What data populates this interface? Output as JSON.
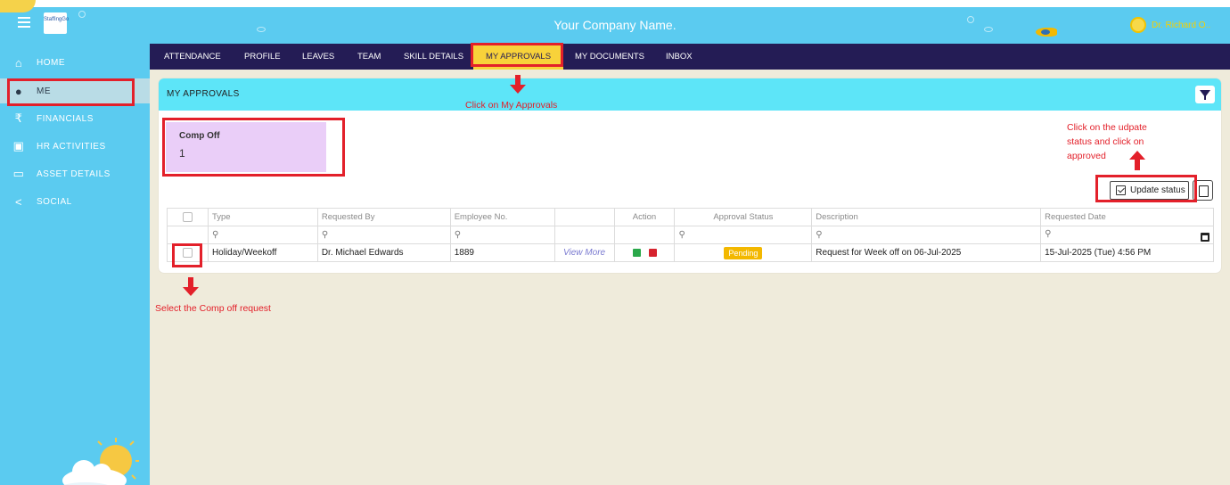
{
  "header": {
    "company_name": "Your Company Name.",
    "logo_text": "StaffingGo",
    "user_name": "Dr. Richard O.."
  },
  "sidebar": {
    "items": [
      {
        "label": "HOME",
        "icon": "home-icon"
      },
      {
        "label": "ME",
        "icon": "person-icon"
      },
      {
        "label": "FINANCIALS",
        "icon": "rupee-icon"
      },
      {
        "label": "HR ACTIVITIES",
        "icon": "id-card-icon"
      },
      {
        "label": "ASSET DETAILS",
        "icon": "monitor-icon"
      },
      {
        "label": "SOCIAL",
        "icon": "share-icon"
      }
    ],
    "active": "ME"
  },
  "menu": {
    "items": [
      "ATTENDANCE",
      "PROFILE",
      "LEAVES",
      "TEAM",
      "SKILL DETAILS",
      "MY APPROVALS",
      "MY DOCUMENTS",
      "INBOX"
    ],
    "active": "MY APPROVALS"
  },
  "panel": {
    "title": "MY APPROVALS",
    "summary_label": "Comp Off",
    "summary_value": "1",
    "update_status_label": "Update status"
  },
  "table": {
    "headers": [
      "",
      "Type",
      "Requested By",
      "Employee No.",
      "",
      "Action",
      "Approval Status",
      "Description",
      "Requested Date"
    ],
    "rows": [
      {
        "type": "Holiday/Weekoff",
        "requested_by": "Dr. Michael Edwards",
        "employee_no": "1889",
        "view_more": "View More",
        "status": "Pending",
        "description": "Request for Week off on 06-Jul-2025",
        "requested_date": "15-Jul-2025 (Tue) 4:56 PM"
      }
    ]
  },
  "annotations": {
    "click_approvals": "Click on My Approvals",
    "update_status_note": "Click on the udpate status and click on approved",
    "select_request": "Select the Comp off request"
  },
  "colors": {
    "header_bg": "#5bcbf0",
    "menubar_bg": "#241c55",
    "active_menu": "#f8d23a",
    "panel_head": "#5de5f8",
    "annotation_red": "#e3202a",
    "pending": "#f3b800"
  }
}
